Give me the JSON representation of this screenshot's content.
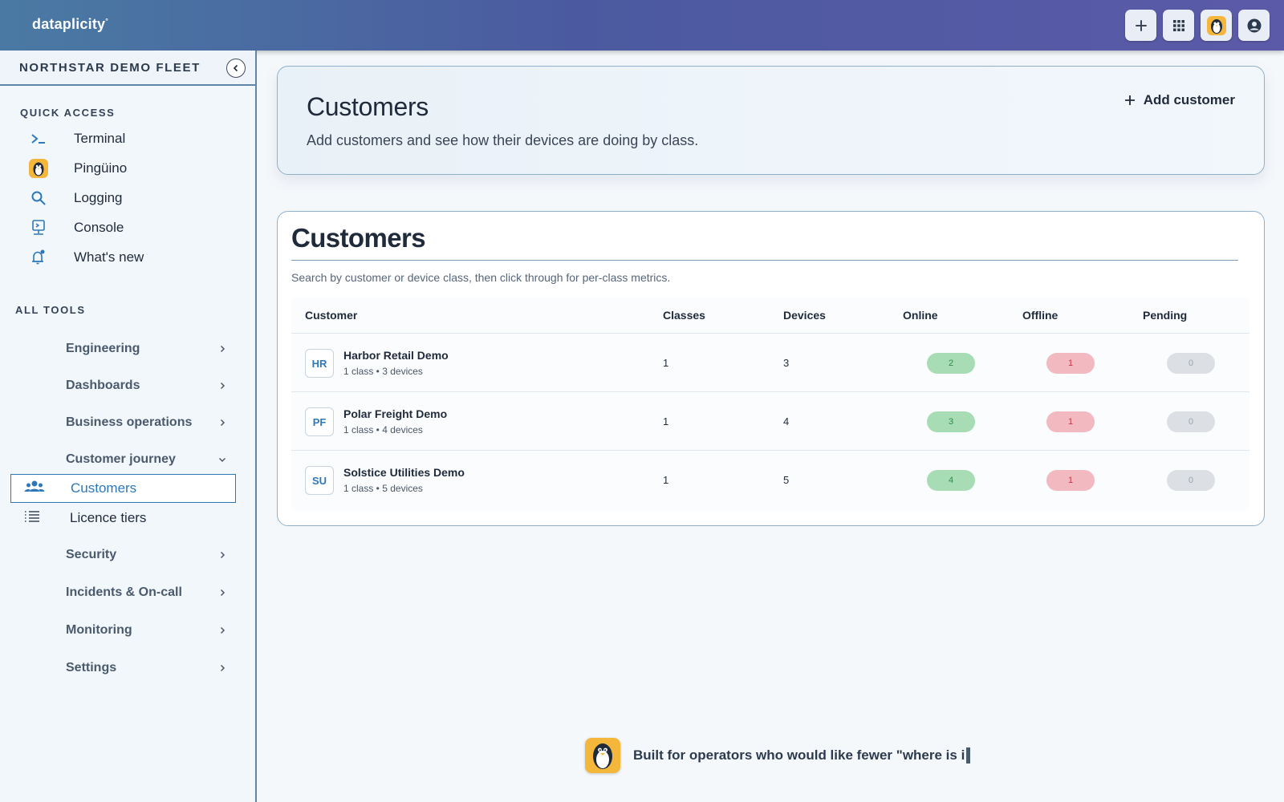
{
  "brand": {
    "name": "dataplicity",
    "mark": "°"
  },
  "topbar": {
    "actions": [
      {
        "name": "add-icon"
      },
      {
        "name": "grid-icon"
      },
      {
        "name": "penguin-icon"
      },
      {
        "name": "account-icon"
      }
    ]
  },
  "sidebar": {
    "fleet_name": "NORTHSTAR DEMO FLEET",
    "quick_access_label": "QUICK ACCESS",
    "quick_access": [
      {
        "label": "Terminal",
        "icon": "terminal-icon"
      },
      {
        "label": "Pingüino",
        "icon": "penguin-icon"
      },
      {
        "label": "Logging",
        "icon": "search-icon"
      },
      {
        "label": "Console",
        "icon": "console-icon"
      },
      {
        "label": "What's new",
        "icon": "bell-icon"
      }
    ],
    "all_tools_label": "ALL TOOLS",
    "tools": [
      {
        "label": "Engineering"
      },
      {
        "label": "Dashboards"
      },
      {
        "label": "Business operations"
      },
      {
        "label": "Customer journey"
      },
      {
        "label": "Security"
      },
      {
        "label": "Incidents & On-call"
      },
      {
        "label": "Monitoring"
      },
      {
        "label": "Settings"
      }
    ],
    "customer_journey_items": [
      {
        "label": "Customers",
        "icon": "users-icon",
        "active": true
      },
      {
        "label": "Licence tiers",
        "icon": "list-icon",
        "active": false
      }
    ]
  },
  "hero": {
    "title": "Customers",
    "subtitle": "Add customers and see how their devices are doing by class.",
    "add_label": "Add customer"
  },
  "customers_card": {
    "title": "Customers",
    "description": "Search by customer or device class, then click through for per-class metrics.",
    "columns": [
      "Customer",
      "Classes",
      "Devices",
      "Online",
      "Offline",
      "Pending"
    ],
    "rows": [
      {
        "initials": "HR",
        "name": "Harbor Retail Demo",
        "sub": "1 class • 3 devices",
        "classes": "1",
        "devices": "3",
        "online": "2",
        "offline": "1",
        "pending": "0"
      },
      {
        "initials": "PF",
        "name": "Polar Freight Demo",
        "sub": "1 class • 4 devices",
        "classes": "1",
        "devices": "4",
        "online": "3",
        "offline": "1",
        "pending": "0"
      },
      {
        "initials": "SU",
        "name": "Solstice Utilities Demo",
        "sub": "1 class • 5 devices",
        "classes": "1",
        "devices": "5",
        "online": "4",
        "offline": "1",
        "pending": "0"
      }
    ]
  },
  "footer": {
    "text": "Built for operators who would like fewer \"where is i"
  },
  "colors": {
    "accent": "#2e78b8",
    "online": "#a8dcb4",
    "offline": "#f3b9c0",
    "pending": "#dcdfe3"
  }
}
